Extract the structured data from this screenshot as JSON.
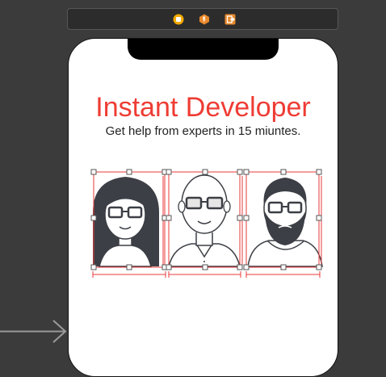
{
  "scene_toolbar": {
    "icons": [
      "view-controller-icon",
      "first-responder-icon",
      "exit-icon"
    ],
    "colors": {
      "vc": "#f2a900",
      "responder": "#e8892c",
      "exit": "#e8892c"
    }
  },
  "screen": {
    "title": "Instant Developer",
    "subtitle": "Get help from experts in 15 miuntes.",
    "title_color": "#ee3c34"
  },
  "avatars": [
    {
      "name": "woman-developer-avatar"
    },
    {
      "name": "bald-developer-avatar"
    },
    {
      "name": "bearded-developer-avatar"
    }
  ],
  "selection_color": "#e8393a"
}
